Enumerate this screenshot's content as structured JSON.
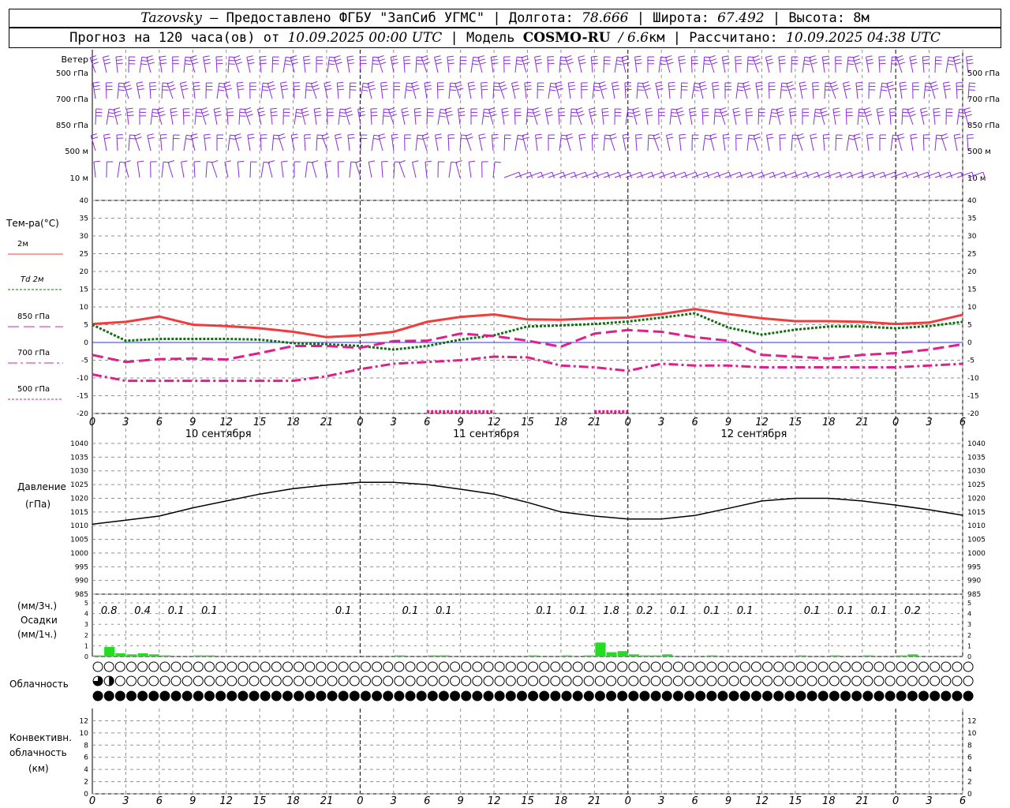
{
  "header": {
    "station": "Tazovsky",
    "provider": "– Предоставлено ФГБУ \"ЗапСиб УГМС\"",
    "lon_label": "Долгота:",
    "lon": "78.666",
    "lat_label": "Широта:",
    "lat": "67.492",
    "alt_label": "Высота:",
    "alt": "8м",
    "forecast_label": "Прогноз на 120 часа(ов) от",
    "forecast_start": "10.09.2025 00:00 UTC",
    "model_label": "Модель",
    "model": "COSMO-RU",
    "resolution": "6.6",
    "resolution_unit": "км",
    "calc_label": "Рассчитано:",
    "calc_time": "10.09.2025 04:38 UTC"
  },
  "chart_data": {
    "hours": [
      "0",
      "3",
      "6",
      "9",
      "12",
      "15",
      "18",
      "21",
      "0",
      "3",
      "6",
      "9",
      "12",
      "15",
      "18",
      "21",
      "0",
      "3",
      "6",
      "9",
      "12",
      "15",
      "18",
      "21",
      "0",
      "3",
      "6"
    ],
    "days": [
      "10 сентября",
      "11 сентября",
      "12 сентября"
    ],
    "colors": {
      "t2m": "#f03c3c",
      "td2m": "#107010",
      "t850": "#e0208a",
      "t700": "#e0208a",
      "t500": "#e0208a",
      "pressure": "#000000",
      "precip": "#22dd22",
      "conv": "#ef8a2c",
      "wind": "#8a2be2",
      "zero": "#3030ff",
      "grid": "#909090"
    },
    "wind": {
      "label": "Ветер",
      "levels": [
        "500 гПа",
        "700 гПа",
        "850 гПа",
        "500 м",
        "10 м"
      ]
    },
    "temperature": {
      "type": "line",
      "ylabel": "Тем-ра(°C)",
      "ylim": [
        -20,
        40
      ],
      "yticks": [
        "40",
        "35",
        "30",
        "25",
        "20",
        "15",
        "10",
        "5",
        "0",
        "-5",
        "-10",
        "-15",
        "-20"
      ],
      "x_hours": [
        0,
        3,
        6,
        9,
        12,
        15,
        18,
        21,
        24,
        27,
        30,
        33,
        36,
        39,
        42,
        45,
        48,
        51,
        54,
        57,
        60,
        63,
        66,
        69,
        72,
        75,
        78
      ],
      "series": [
        {
          "name": "2м",
          "key": "t2m",
          "style": "solid",
          "values": [
            5.2,
            5.8,
            7.3,
            5.0,
            4.6,
            4.0,
            3.0,
            1.5,
            2.0,
            3.0,
            5.8,
            7.2,
            7.9,
            6.5,
            6.4,
            6.8,
            7.0,
            8.0,
            9.4,
            8.0,
            6.8,
            6.0,
            6.0,
            5.8,
            5.2,
            5.6,
            7.8
          ]
        },
        {
          "name": "Td 2м",
          "key": "td2m",
          "style": "dotted",
          "values": [
            5.0,
            0.5,
            1.0,
            1.0,
            1.0,
            0.8,
            -0.2,
            -0.5,
            -1.0,
            -2.0,
            -1.0,
            0.8,
            2.0,
            4.5,
            4.8,
            5.2,
            5.9,
            7.0,
            8.2,
            4.2,
            2.2,
            3.6,
            4.5,
            4.5,
            4.0,
            4.6,
            5.8
          ]
        },
        {
          "name": "850 гПа",
          "key": "t850",
          "style": "longdash",
          "values": [
            -3.5,
            -5.5,
            -4.7,
            -4.5,
            -4.8,
            -3.0,
            -1.0,
            -1.0,
            -1.5,
            0.4,
            0.5,
            2.5,
            1.8,
            0.5,
            -1.2,
            2.5,
            3.5,
            3.0,
            1.5,
            0.5,
            -3.5,
            -4.0,
            -4.5,
            -3.5,
            -3.0,
            -2.0,
            -0.5
          ]
        },
        {
          "name": "700 гПа",
          "key": "t700",
          "style": "dashdot",
          "values": [
            -9.0,
            -10.8,
            -10.8,
            -10.8,
            -10.8,
            -10.8,
            -10.8,
            -9.5,
            -7.5,
            -6.0,
            -5.5,
            -5.0,
            -4.0,
            -4.2,
            -6.5,
            -7.0,
            -8.0,
            -6.0,
            -6.5,
            -6.5,
            -7.0,
            -7.0,
            -7.0,
            -7.0,
            -7.0,
            -6.5,
            -6.0
          ]
        },
        {
          "name": "500 гПа",
          "key": "t500",
          "style": "dotted",
          "values": [
            null,
            null,
            null,
            null,
            null,
            null,
            null,
            null,
            null,
            null,
            -19.5,
            -19.5,
            -19.5,
            null,
            null,
            -19.5,
            -19.5,
            null,
            null,
            null,
            null,
            null,
            null,
            null,
            null,
            null,
            null
          ]
        }
      ]
    },
    "pressure": {
      "type": "line",
      "ylabel": "Давление",
      "unit": "(гПа)",
      "ylim": [
        985,
        1040
      ],
      "yticks": [
        "1040",
        "1035",
        "1030",
        "1025",
        "1020",
        "1015",
        "1010",
        "1005",
        "1000",
        "995",
        "990",
        "985"
      ],
      "x_hours": [
        0,
        3,
        6,
        9,
        12,
        15,
        18,
        21,
        24,
        27,
        30,
        33,
        36,
        39,
        42,
        45,
        48,
        51,
        54,
        57,
        60,
        63,
        66,
        69,
        72,
        75,
        78
      ],
      "values": [
        1010.5,
        1012.0,
        1013.5,
        1016.5,
        1019.0,
        1021.5,
        1023.5,
        1024.8,
        1025.8,
        1025.8,
        1025.0,
        1023.3,
        1021.5,
        1018.5,
        1015.0,
        1013.5,
        1012.4,
        1012.4,
        1013.7,
        1016.3,
        1019.0,
        1020.0,
        1020.0,
        1019.0,
        1017.5,
        1015.8,
        1013.8
      ]
    },
    "precipitation": {
      "type": "bar",
      "ylabel_3h": "(мм/3ч.)",
      "ylabel": "Осадки",
      "ylabel_1h": "(мм/1ч.)",
      "ylim": [
        0,
        5
      ],
      "yticks": [
        "5",
        "4",
        "3",
        "2",
        "1",
        "0"
      ],
      "totals_3h": [
        {
          "hour": 1.5,
          "value": "0.8"
        },
        {
          "hour": 4.5,
          "value": "0.4"
        },
        {
          "hour": 7.5,
          "value": "0.1"
        },
        {
          "hour": 10.5,
          "value": "0.1"
        },
        {
          "hour": 22.5,
          "value": "0.1"
        },
        {
          "hour": 28.5,
          "value": "0.1"
        },
        {
          "hour": 31.5,
          "value": "0.1"
        },
        {
          "hour": 40.5,
          "value": "0.1"
        },
        {
          "hour": 43.5,
          "value": "0.1"
        },
        {
          "hour": 46.5,
          "value": "1.8"
        },
        {
          "hour": 49.5,
          "value": "0.2"
        },
        {
          "hour": 52.5,
          "value": "0.1"
        },
        {
          "hour": 55.5,
          "value": "0.1"
        },
        {
          "hour": 58.5,
          "value": "0.1"
        },
        {
          "hour": 64.5,
          "value": "0.1"
        },
        {
          "hour": 67.5,
          "value": "0.1"
        },
        {
          "hour": 70.5,
          "value": "0.1"
        },
        {
          "hour": 73.5,
          "value": "0.2"
        }
      ],
      "hourly": [
        [
          1,
          0.1
        ],
        [
          2,
          0.9
        ],
        [
          3,
          0.3
        ],
        [
          4,
          0.2
        ],
        [
          5,
          0.3
        ],
        [
          6,
          0.2
        ],
        [
          7,
          0.1
        ],
        [
          10,
          0.1
        ],
        [
          11,
          0.1
        ],
        [
          28,
          0.1
        ],
        [
          31,
          0.1
        ],
        [
          32,
          0.1
        ],
        [
          40,
          0.1
        ],
        [
          43,
          0.1
        ],
        [
          45,
          0.1
        ],
        [
          46,
          1.3
        ],
        [
          47,
          0.4
        ],
        [
          48,
          0.5
        ],
        [
          49,
          0.2
        ],
        [
          50,
          0.1
        ],
        [
          51,
          0.1
        ],
        [
          52,
          0.2
        ],
        [
          56,
          0.1
        ],
        [
          64,
          0.1
        ],
        [
          67,
          0.1
        ],
        [
          70,
          0.1
        ],
        [
          73,
          0.1
        ],
        [
          74,
          0.2
        ]
      ]
    },
    "cloud": {
      "ylabel": "Облачность",
      "low": "0000000000000000000000000000000000000000000000000000000000000000000000000000000",
      "mid": "3200000000000000000000000000000000000000000000000000000000000000000000000000000",
      "high": "4444444444444444444444444444444444444444444444444444444444444444444444444444444"
    },
    "convective": {
      "type": "bar",
      "ylabel": "Конвективн.",
      "ylabel2": "облачность",
      "unit": "(км)",
      "ylim": [
        0,
        14
      ],
      "yticks": [
        "12",
        "10",
        "8",
        "6",
        "4",
        "2",
        "0"
      ]
    }
  }
}
